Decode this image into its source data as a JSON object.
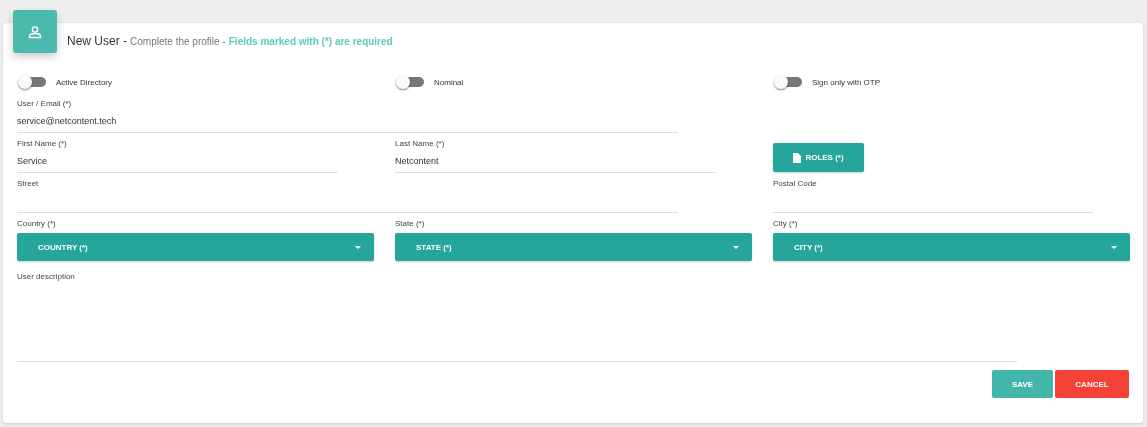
{
  "header": {
    "title": "New User -",
    "subtitle": "Complete the profile -",
    "required_note": "Fields marked with (*) are required"
  },
  "toggles": [
    {
      "label": "Active Directory",
      "on": false
    },
    {
      "label": "Nominal",
      "on": false
    },
    {
      "label": "Sign only with OTP",
      "on": false
    }
  ],
  "user_email": {
    "label": "User / Email (*)",
    "value": "service@netcontent.tech"
  },
  "first_name": {
    "label": "First Name (*)",
    "value": "Service"
  },
  "last_name": {
    "label": "Last Name (*)",
    "value": "Netcontent"
  },
  "roles_button": "ROLES (*)",
  "street": {
    "label": "Street"
  },
  "postal_code": {
    "label": "Postal Code"
  },
  "dropdowns": [
    {
      "label": "Country (*)",
      "value": "COUNTRY (*)"
    },
    {
      "label": "State (*)",
      "value": "STATE (*)"
    },
    {
      "label": "City (*)",
      "value": "CITY (*)"
    }
  ],
  "description": {
    "label": "User description"
  },
  "buttons": {
    "save": "SAVE",
    "cancel": "CANCEL"
  }
}
